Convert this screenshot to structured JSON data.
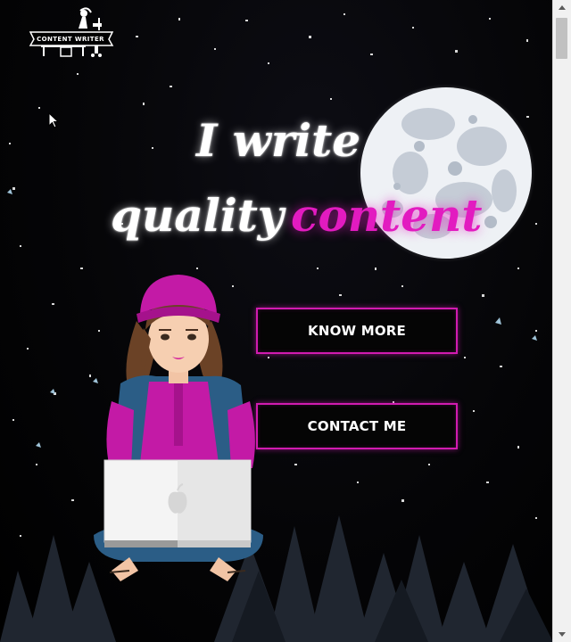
{
  "logo": {
    "text": "CONTENT WRITER"
  },
  "hero": {
    "line1": "I write",
    "line2": "quality",
    "line2_accent": "content"
  },
  "buttons": {
    "know_more": "KNOW MORE",
    "contact_me": "CONTACT ME"
  },
  "colors": {
    "accent": "#e21bc0",
    "button_border": "#d11bb0",
    "background": "#000000"
  },
  "icons": {
    "moon": "moon-illustration",
    "girl": "writer-girl-illustration",
    "laptop_logo": "apple-icon",
    "cursor": "mouse-pointer-icon"
  }
}
